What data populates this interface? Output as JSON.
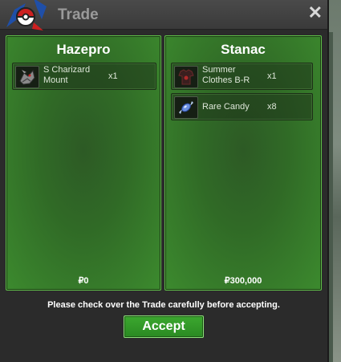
{
  "window": {
    "title": "Trade"
  },
  "icons": {
    "close": "close-icon",
    "logo": "pokeball-logo-icon"
  },
  "left_panel": {
    "player": "Hazepro",
    "items": [
      {
        "name": "S Charizard Mount",
        "qty": "x1",
        "icon": "charizard-mount-icon"
      }
    ],
    "money": "₽0"
  },
  "right_panel": {
    "player": "Stanac",
    "items": [
      {
        "name": "Summer Clothes B-R",
        "qty": "x1",
        "icon": "summer-clothes-icon"
      },
      {
        "name": "Rare Candy",
        "qty": "x8",
        "icon": "rare-candy-icon"
      }
    ],
    "money": "₽300,000"
  },
  "notice": "Please check over the Trade carefully before accepting.",
  "accept_label": "Accept",
  "colors": {
    "panel_green": "#306a26",
    "accept_green": "#2f9a26",
    "title_gray": "#9a9a9a"
  }
}
